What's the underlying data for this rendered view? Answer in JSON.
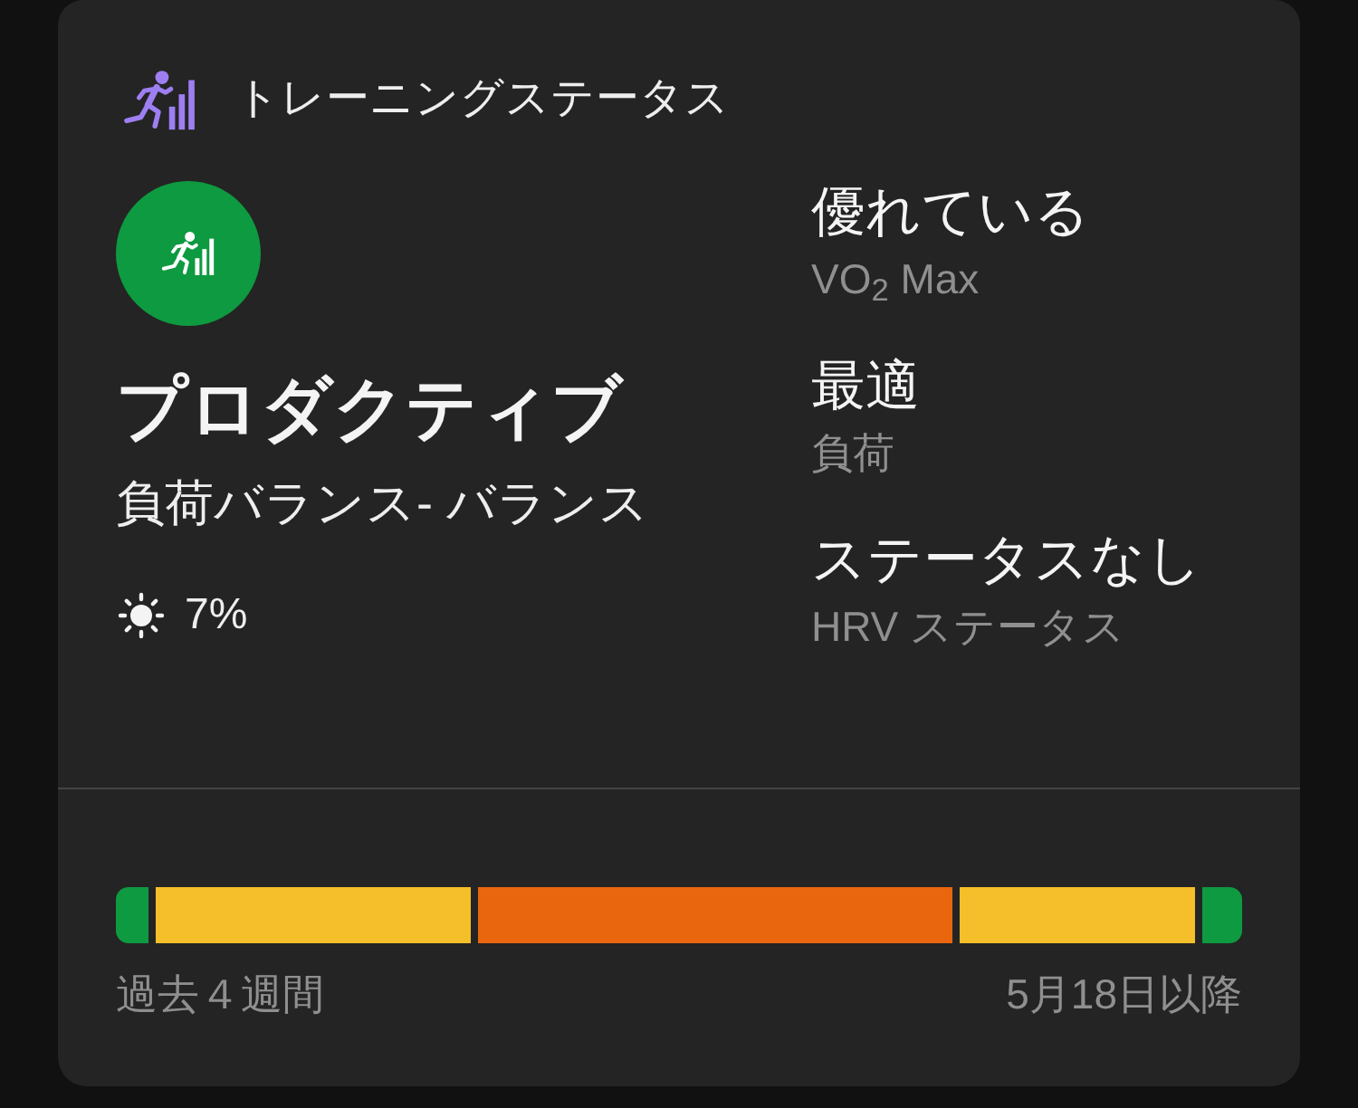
{
  "header": {
    "title": "トレーニングステータス"
  },
  "status": {
    "title": "プロダクティブ",
    "subtitle": "負荷バランス- バランス",
    "heat_reading": "7%"
  },
  "metrics": [
    {
      "value": "優れている",
      "label": "VO$_{2}$ Max"
    },
    {
      "value": "最適",
      "label": "負荷"
    },
    {
      "value": "ステータスなし",
      "label": "HRV ステータス"
    }
  ],
  "load_bar": {
    "segments": [
      {
        "color": "#0e9a40"
      },
      {
        "color": "#f4bf2a"
      },
      {
        "color": "#e9660f"
      },
      {
        "color": "#f4bf2a"
      },
      {
        "color": "#0e9a40"
      }
    ],
    "start_label": "過去４週間",
    "end_label": "5月18日以降"
  }
}
